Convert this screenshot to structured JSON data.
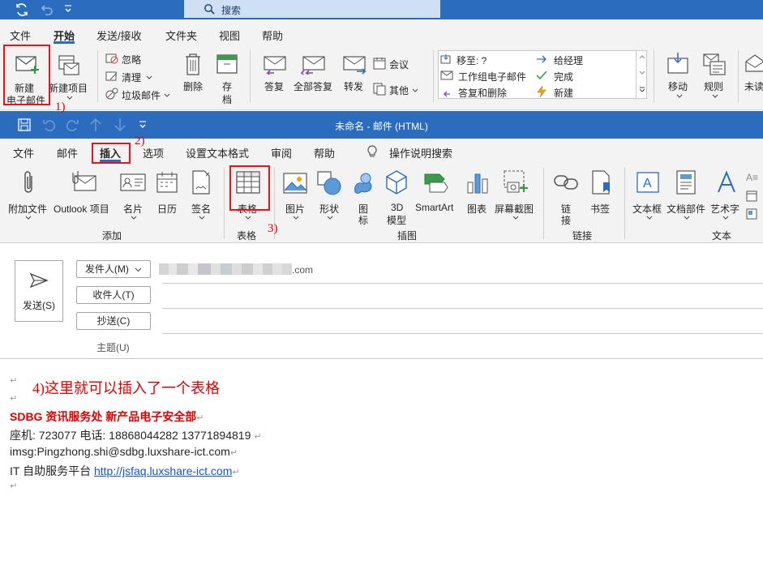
{
  "main_window": {
    "search_placeholder": "搜索",
    "menu_tabs": [
      "文件",
      "开始",
      "发送/接收",
      "文件夹",
      "视图",
      "帮助"
    ],
    "active_tab": "开始",
    "ribbon": {
      "new_email": [
        "新建",
        "电子邮件"
      ],
      "new_item": "新建项目",
      "ignore": "忽略",
      "clean_up": "清理",
      "junk": "垃圾邮件",
      "delete": "删除",
      "archive": [
        "存",
        "档"
      ],
      "reply": "答复",
      "reply_all": "全部答复",
      "forward": "转发",
      "meeting": "会议",
      "more": "其他",
      "quick_steps": [
        "移至: ?",
        "给经理",
        "工作组电子邮件",
        "完成",
        "答复和删除",
        "新建"
      ],
      "move": "移动",
      "rules": "规则",
      "unread": "未读"
    }
  },
  "compose_window": {
    "title": "未命名  -  邮件 (HTML)",
    "menu_tabs": [
      "文件",
      "邮件",
      "插入",
      "选项",
      "设置文本格式",
      "审阅",
      "帮助"
    ],
    "active_tab": "插入",
    "tell_me": "操作说明搜索",
    "ribbon": {
      "attach_file": "附加文件",
      "outlook_item": "Outlook 项目",
      "business_card": "名片",
      "calendar": "日历",
      "signature": "签名",
      "group_add": "添加",
      "table": "表格",
      "group_table": "表格",
      "picture": "图片",
      "shapes": "形状",
      "icons": [
        "图",
        "标"
      ],
      "model_3d": [
        "3D",
        "模型"
      ],
      "smartart": "SmartArt",
      "chart": "图表",
      "screenshot": "屏幕截图",
      "group_illustrations": "插图",
      "link": [
        "链",
        "接"
      ],
      "bookmark": "书签",
      "group_links": "链接",
      "textbox": "文本框",
      "quick_parts": "文档部件",
      "wordart": "艺术字",
      "group_text": "文本"
    },
    "header": {
      "send": "发送(S)",
      "from": "发件人(M)",
      "from_suffix": ".com",
      "to": "收件人(T)",
      "cc": "抄送(C)",
      "subject": "主题(U)"
    },
    "body": {
      "para_mark": "↵",
      "annotation_line": "4)这里就可以插入了一个表格",
      "sig_dept": "SDBG  资讯服务处  新产品电子安全部",
      "sig_phone": "座机:  723077        电话:  18868044282    13771894819    ",
      "sig_email": "imsg:Pingzhong.shi@sdbg.luxshare-ict.com",
      "sig_it_label": "IT 自助服务平台  ",
      "sig_it_link": "http://jsfaq.luxshare-ict.com"
    }
  },
  "annotations": {
    "step1": "1)",
    "step2": "2)",
    "step3": "3)",
    "color": "#e00000"
  },
  "colors": {
    "titlebar": "#2b6cbf",
    "ribbon_bg": "#f3f3f3",
    "highlight": "#e8141b"
  }
}
